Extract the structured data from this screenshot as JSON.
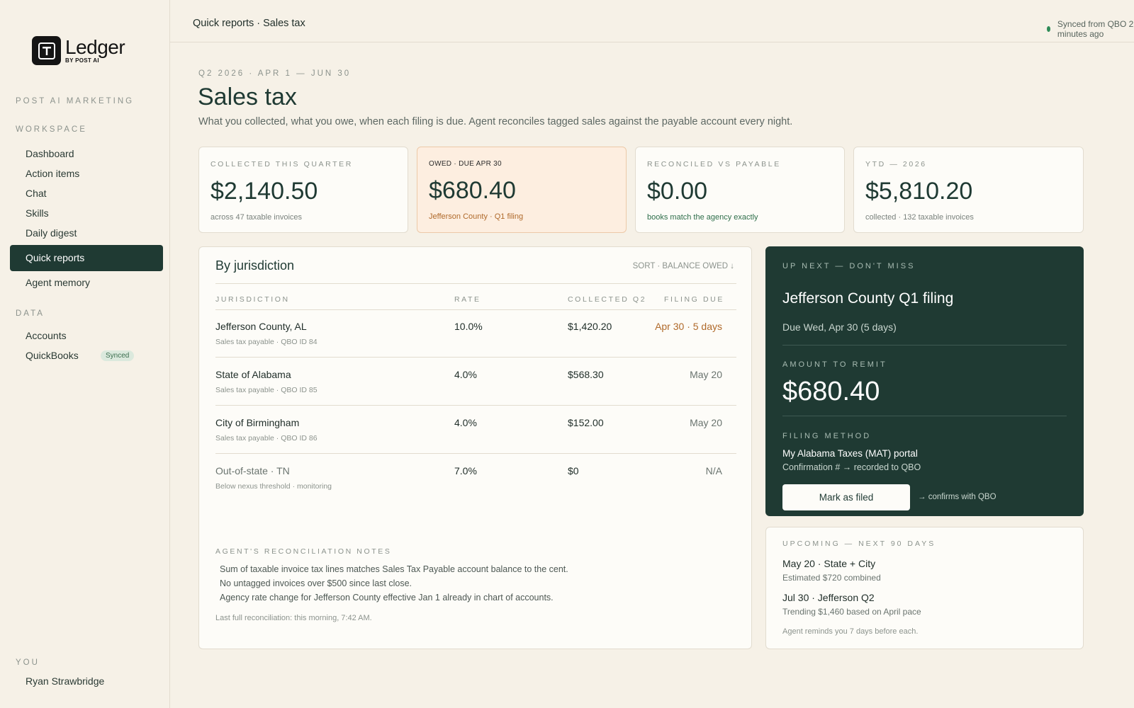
{
  "brand": {
    "name": "Ledger",
    "sub": "BY POST AI"
  },
  "sidebar": {
    "org": "POST AI MARKETING",
    "workspace_label": "WORKSPACE",
    "workspace_items": [
      "Dashboard",
      "Action items",
      "Chat",
      "Skills",
      "Daily digest",
      "Quick reports",
      "Agent memory"
    ],
    "active_item": "Quick reports",
    "data_label": "DATA",
    "data_items": [
      "Accounts",
      "QuickBooks"
    ],
    "quickbooks_badge": "Synced",
    "you_label": "YOU",
    "user_name": "Ryan Strawbridge"
  },
  "header": {
    "breadcrumb": "Quick reports · Sales tax",
    "sync_status": "Synced from QBO 2 minutes ago",
    "sync_color": "#2e8b57"
  },
  "page": {
    "eyebrow": "Q2 2026 · APR 1 — JUN 30",
    "title": "Sales tax",
    "subtitle": "What you collected, what you owe, when each filing is due. Agent reconciles tagged sales against the payable account every night."
  },
  "stats": [
    {
      "label": "COLLECTED THIS QUARTER",
      "value": "$2,140.50",
      "sub": "across 47 taxable invoices"
    },
    {
      "label": "OWED · DUE APR 30",
      "value": "$680.40",
      "sub": "Jefferson County · Q1 filing"
    },
    {
      "label": "RECONCILED VS PAYABLE",
      "value": "$0.00",
      "sub": "books match the agency exactly"
    },
    {
      "label": "YTD — 2026",
      "value": "$5,810.20",
      "sub": "collected · 132 taxable invoices"
    }
  ],
  "jurisdiction": {
    "title": "By jurisdiction",
    "sort": "SORT · BALANCE OWED ↓",
    "columns": [
      "JURISDICTION",
      "RATE",
      "COLLECTED Q2",
      "FILING DUE"
    ],
    "rows": [
      {
        "name": "Jefferson County, AL",
        "meta": "Sales tax payable · QBO ID 84",
        "rate": "10.0%",
        "collected": "$1,420.20",
        "due": "Apr 30 · 5 days"
      },
      {
        "name": "State of Alabama",
        "meta": "Sales tax payable · QBO ID 85",
        "rate": "4.0%",
        "collected": "$568.30",
        "due": "May 20"
      },
      {
        "name": "City of Birmingham",
        "meta": "Sales tax payable · QBO ID 86",
        "rate": "4.0%",
        "collected": "$152.00",
        "due": "May 20"
      },
      {
        "name": "Out-of-state · TN",
        "meta": "Below nexus threshold · monitoring",
        "rate": "7.0%",
        "collected": "$0",
        "due": "N/A"
      }
    ],
    "notes_label": "AGENT'S RECONCILIATION NOTES",
    "notes": [
      "Sum of taxable invoice tax lines matches Sales Tax Payable account balance to the cent.",
      "No untagged invoices over $500 since last close.",
      "Agency rate change for Jefferson County effective Jan 1 already in chart of accounts."
    ],
    "last_reconciliation": "Last full reconciliation: this morning, 7:42 AM."
  },
  "up_next": {
    "label": "UP NEXT — DON'T MISS",
    "title": "Jefferson County Q1 filing",
    "due": "Due Wed, Apr 30 (5 days)",
    "amount_label": "AMOUNT TO REMIT",
    "amount": "$680.40",
    "method_label": "FILING METHOD",
    "method": "My Alabama Taxes (MAT) portal",
    "confirmation": "Confirmation # → recorded to QBO",
    "button": "Mark as filed",
    "button_note": "→ confirms with QBO"
  },
  "upcoming": {
    "label": "UPCOMING — NEXT 90 DAYS",
    "items": [
      {
        "title": "May 20 · State + City",
        "sub": "Estimated $720 combined"
      },
      {
        "title": "Jul 30 · Jefferson Q2",
        "sub": "Trending $1,460 based on April pace"
      }
    ],
    "footer": "Agent reminds you 7 days before each."
  },
  "colors": {
    "accent": "#1f3a33",
    "warning": "#b06a2b",
    "success": "#2e6e4a",
    "background": "#f6f1e7"
  }
}
